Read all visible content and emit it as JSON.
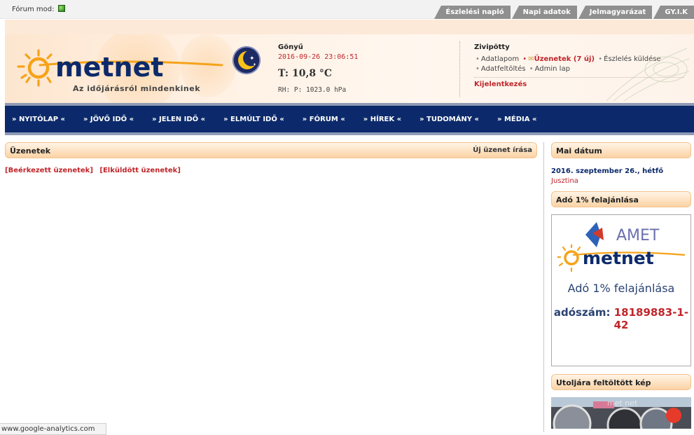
{
  "topbar": {
    "forum_mod_label": "Fórum mod:",
    "tabs": [
      "Észlelési napló",
      "Napi adatok",
      "Jelmagyarázat",
      "GY.I.K"
    ]
  },
  "header": {
    "logo_text": "metnet",
    "slogan": "Az időjárásról mindenkinek",
    "station": {
      "name": "Gönyű",
      "datetime": "2016-09-26 23:06:51",
      "temperature": "T: 10,8 °C",
      "rh_pressure": "RH:  P: 1023.0 hPa"
    },
    "user": {
      "name": "Zivipötty",
      "links": {
        "profile": "Adatlapom",
        "messages": "Üzenetek (7 új)",
        "send_obs": "Észlelés küldése",
        "upload": "Adatfeltöltés",
        "admin": "Admin lap"
      },
      "logout": "Kijelentkezés"
    }
  },
  "nav": [
    "» NYITÓLAP «",
    "» JÖVŐ IDŐ «",
    "» JELEN IDŐ «",
    "» ELMÚLT IDŐ «",
    "» FÓRUM «",
    "» HÍREK «",
    "» TUDOMÁNY «",
    "» MÉDIA «"
  ],
  "main": {
    "title": "Üzenetek",
    "new_message": "Új üzenet írása",
    "inbox": "[Beérkezett üzenetek]",
    "sent": "[Elküldött üzenetek]"
  },
  "sidebar": {
    "date_title": "Mai dátum",
    "date": "2016. szeptember 26., hétfő",
    "nameday": "Jusztina",
    "ado_title": "Adó 1% felajánlása",
    "banner": {
      "amet": "AMET",
      "metnet": "metnet",
      "ado_text": "Adó 1% felajánlása",
      "adoszam_label": "adószám:",
      "adoszam": "18189883-1-42"
    },
    "last_image_title": "Utoljára feltöltött kép",
    "photo_watermark": "met net"
  },
  "status_bar": "www.google-analytics.com",
  "colors": {
    "nav_bg": "#0c2a6b",
    "accent_red": "#c0252a",
    "pill_orange": "#fbd3a4",
    "logo_orange": "#f5a31a"
  }
}
